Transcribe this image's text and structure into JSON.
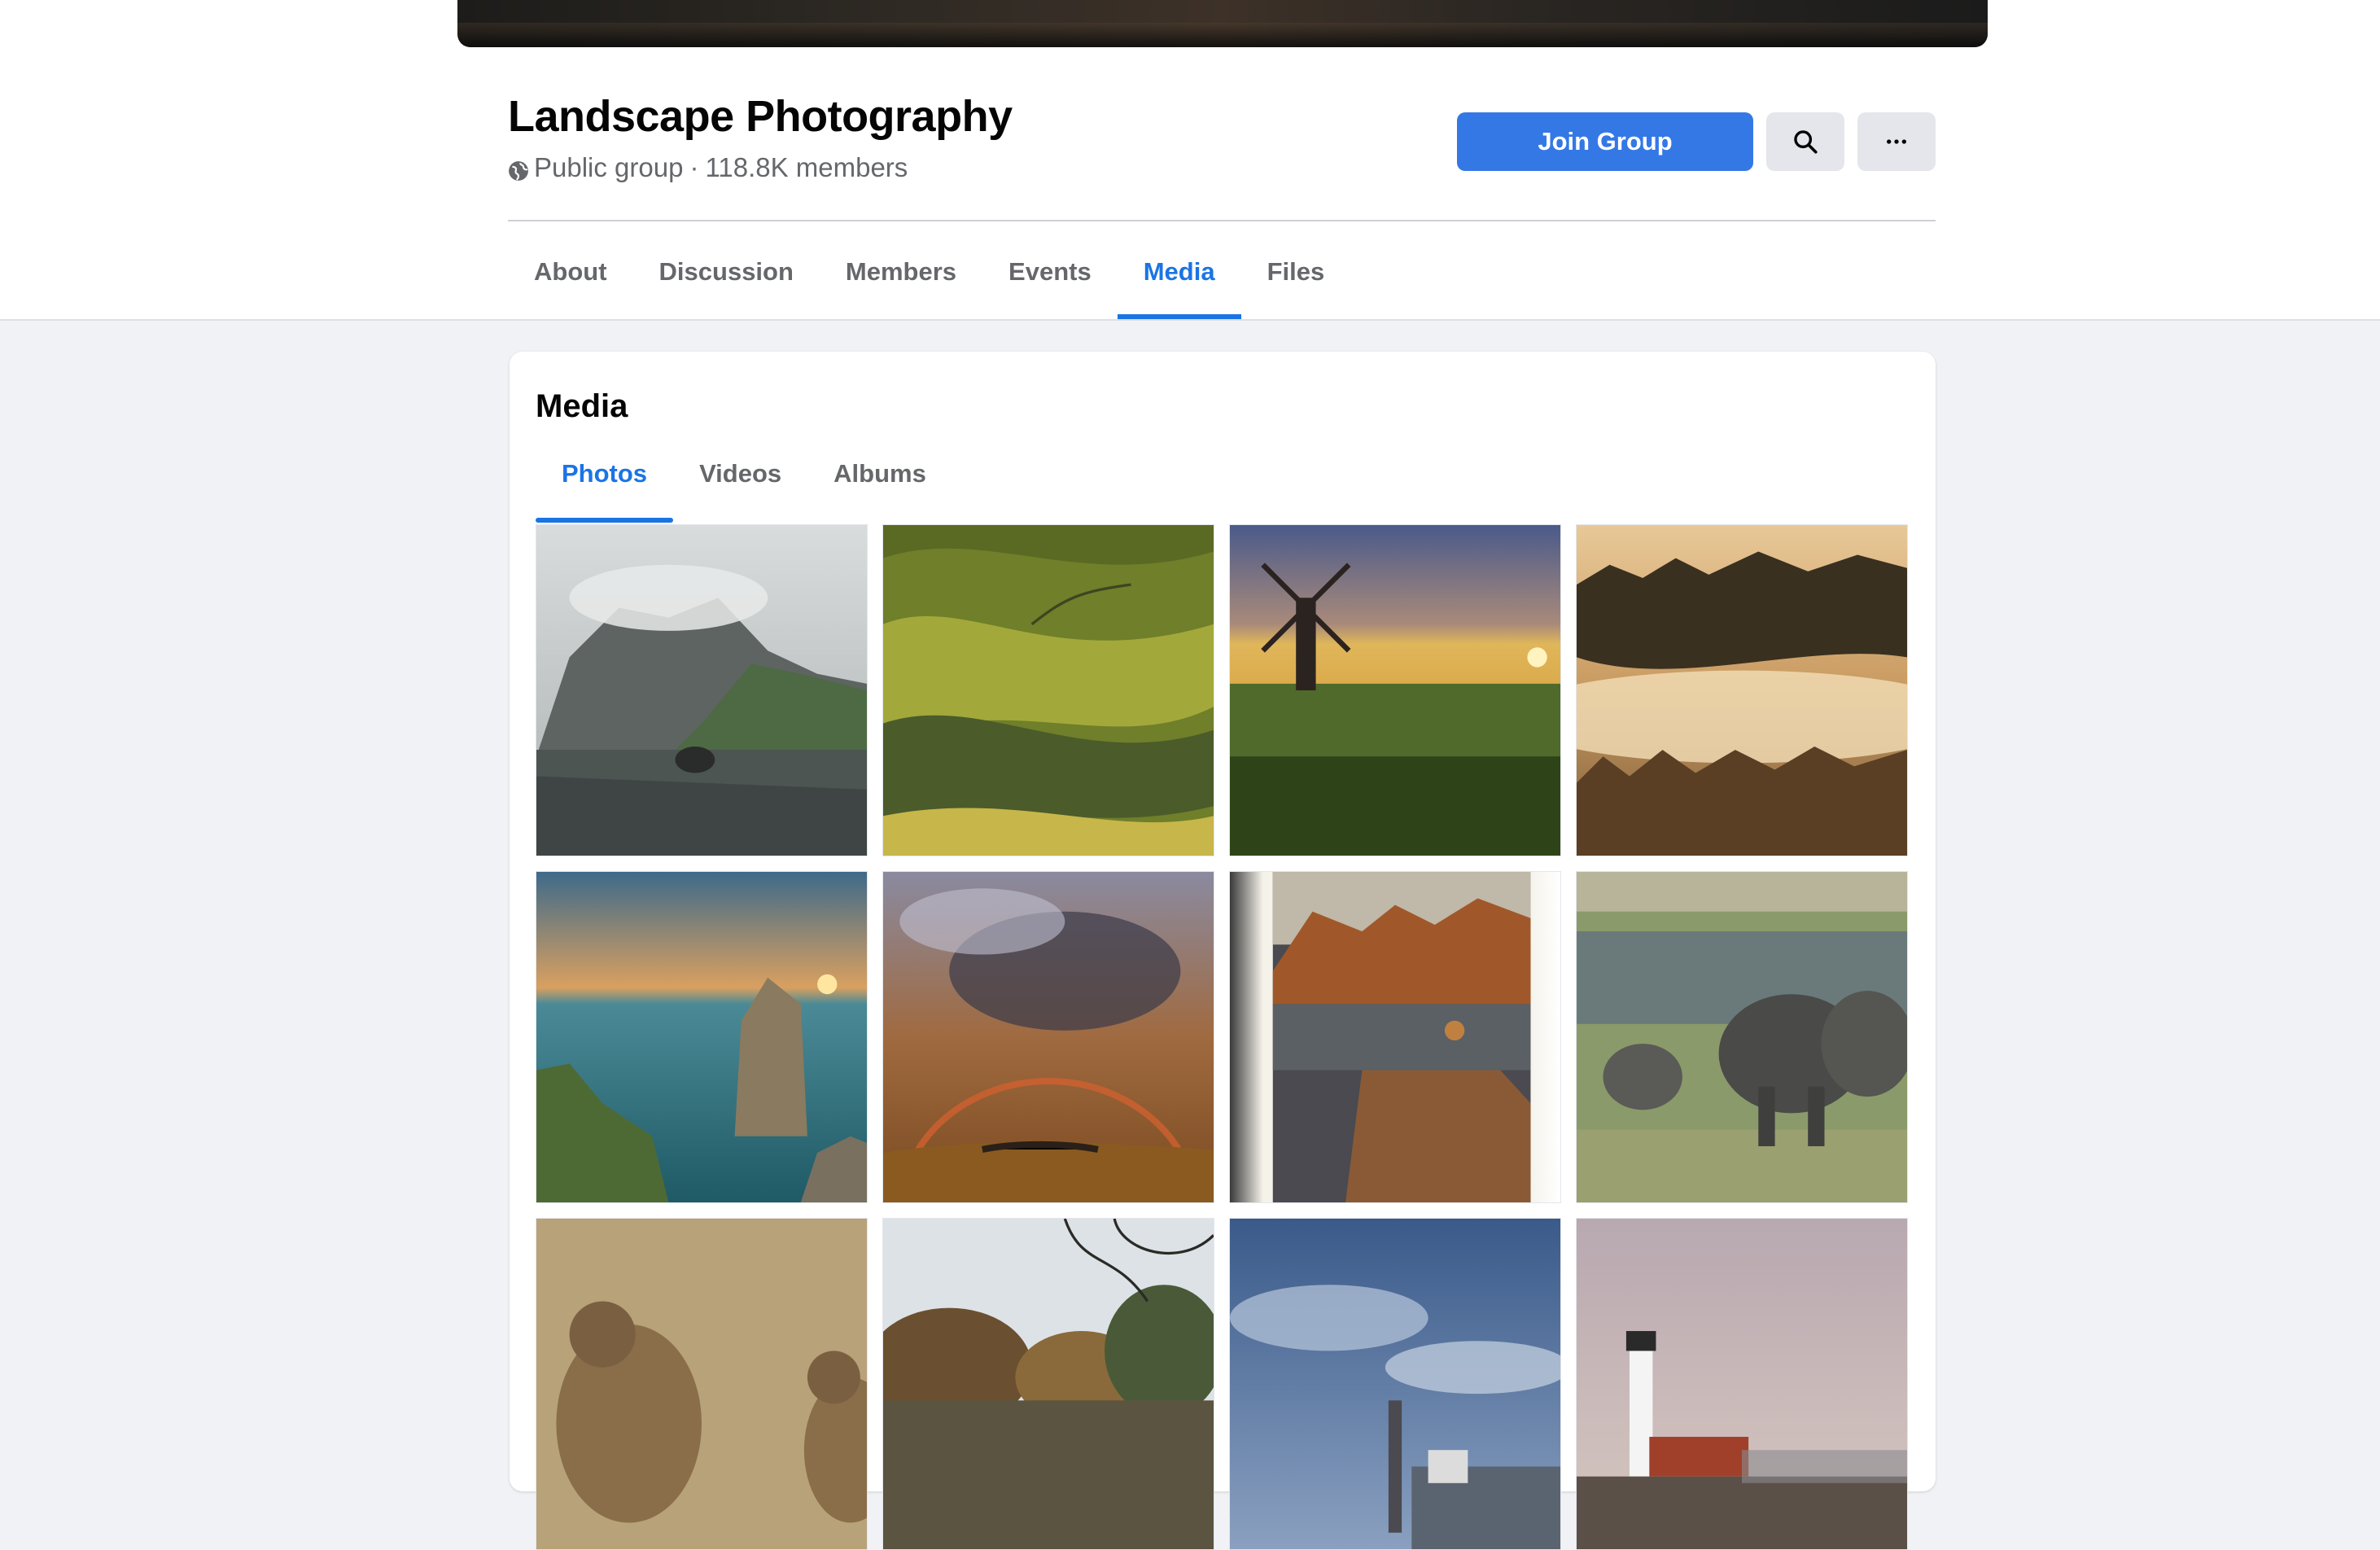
{
  "group": {
    "title": "Landscape Photography",
    "privacy": "Public group",
    "separator": "·",
    "members": "118.8K members",
    "privacy_icon": "globe-icon"
  },
  "actions": {
    "join_label": "Join Group",
    "search_icon": "search-icon",
    "more_icon": "more-dots-icon",
    "accent": "#3478e5"
  },
  "main_tabs": [
    {
      "label": "About",
      "active": false
    },
    {
      "label": "Discussion",
      "active": false
    },
    {
      "label": "Members",
      "active": false
    },
    {
      "label": "Events",
      "active": false
    },
    {
      "label": "Media",
      "active": true
    },
    {
      "label": "Files",
      "active": false
    }
  ],
  "media": {
    "title": "Media",
    "tabs": [
      {
        "label": "Photos",
        "active": true
      },
      {
        "label": "Videos",
        "active": false
      },
      {
        "label": "Albums",
        "active": false
      }
    ],
    "photos": [
      {
        "scene": "mountain-lake"
      },
      {
        "scene": "green-hills"
      },
      {
        "scene": "windmill-sunset"
      },
      {
        "scene": "foggy-forest"
      },
      {
        "scene": "sea-stack-sunset"
      },
      {
        "scene": "storm-rainbow"
      },
      {
        "scene": "coastal-rocks"
      },
      {
        "scene": "elephants"
      },
      {
        "scene": "birds"
      },
      {
        "scene": "autumn-river"
      },
      {
        "scene": "cloudy-harbor"
      },
      {
        "scene": "lighthouse"
      }
    ]
  }
}
